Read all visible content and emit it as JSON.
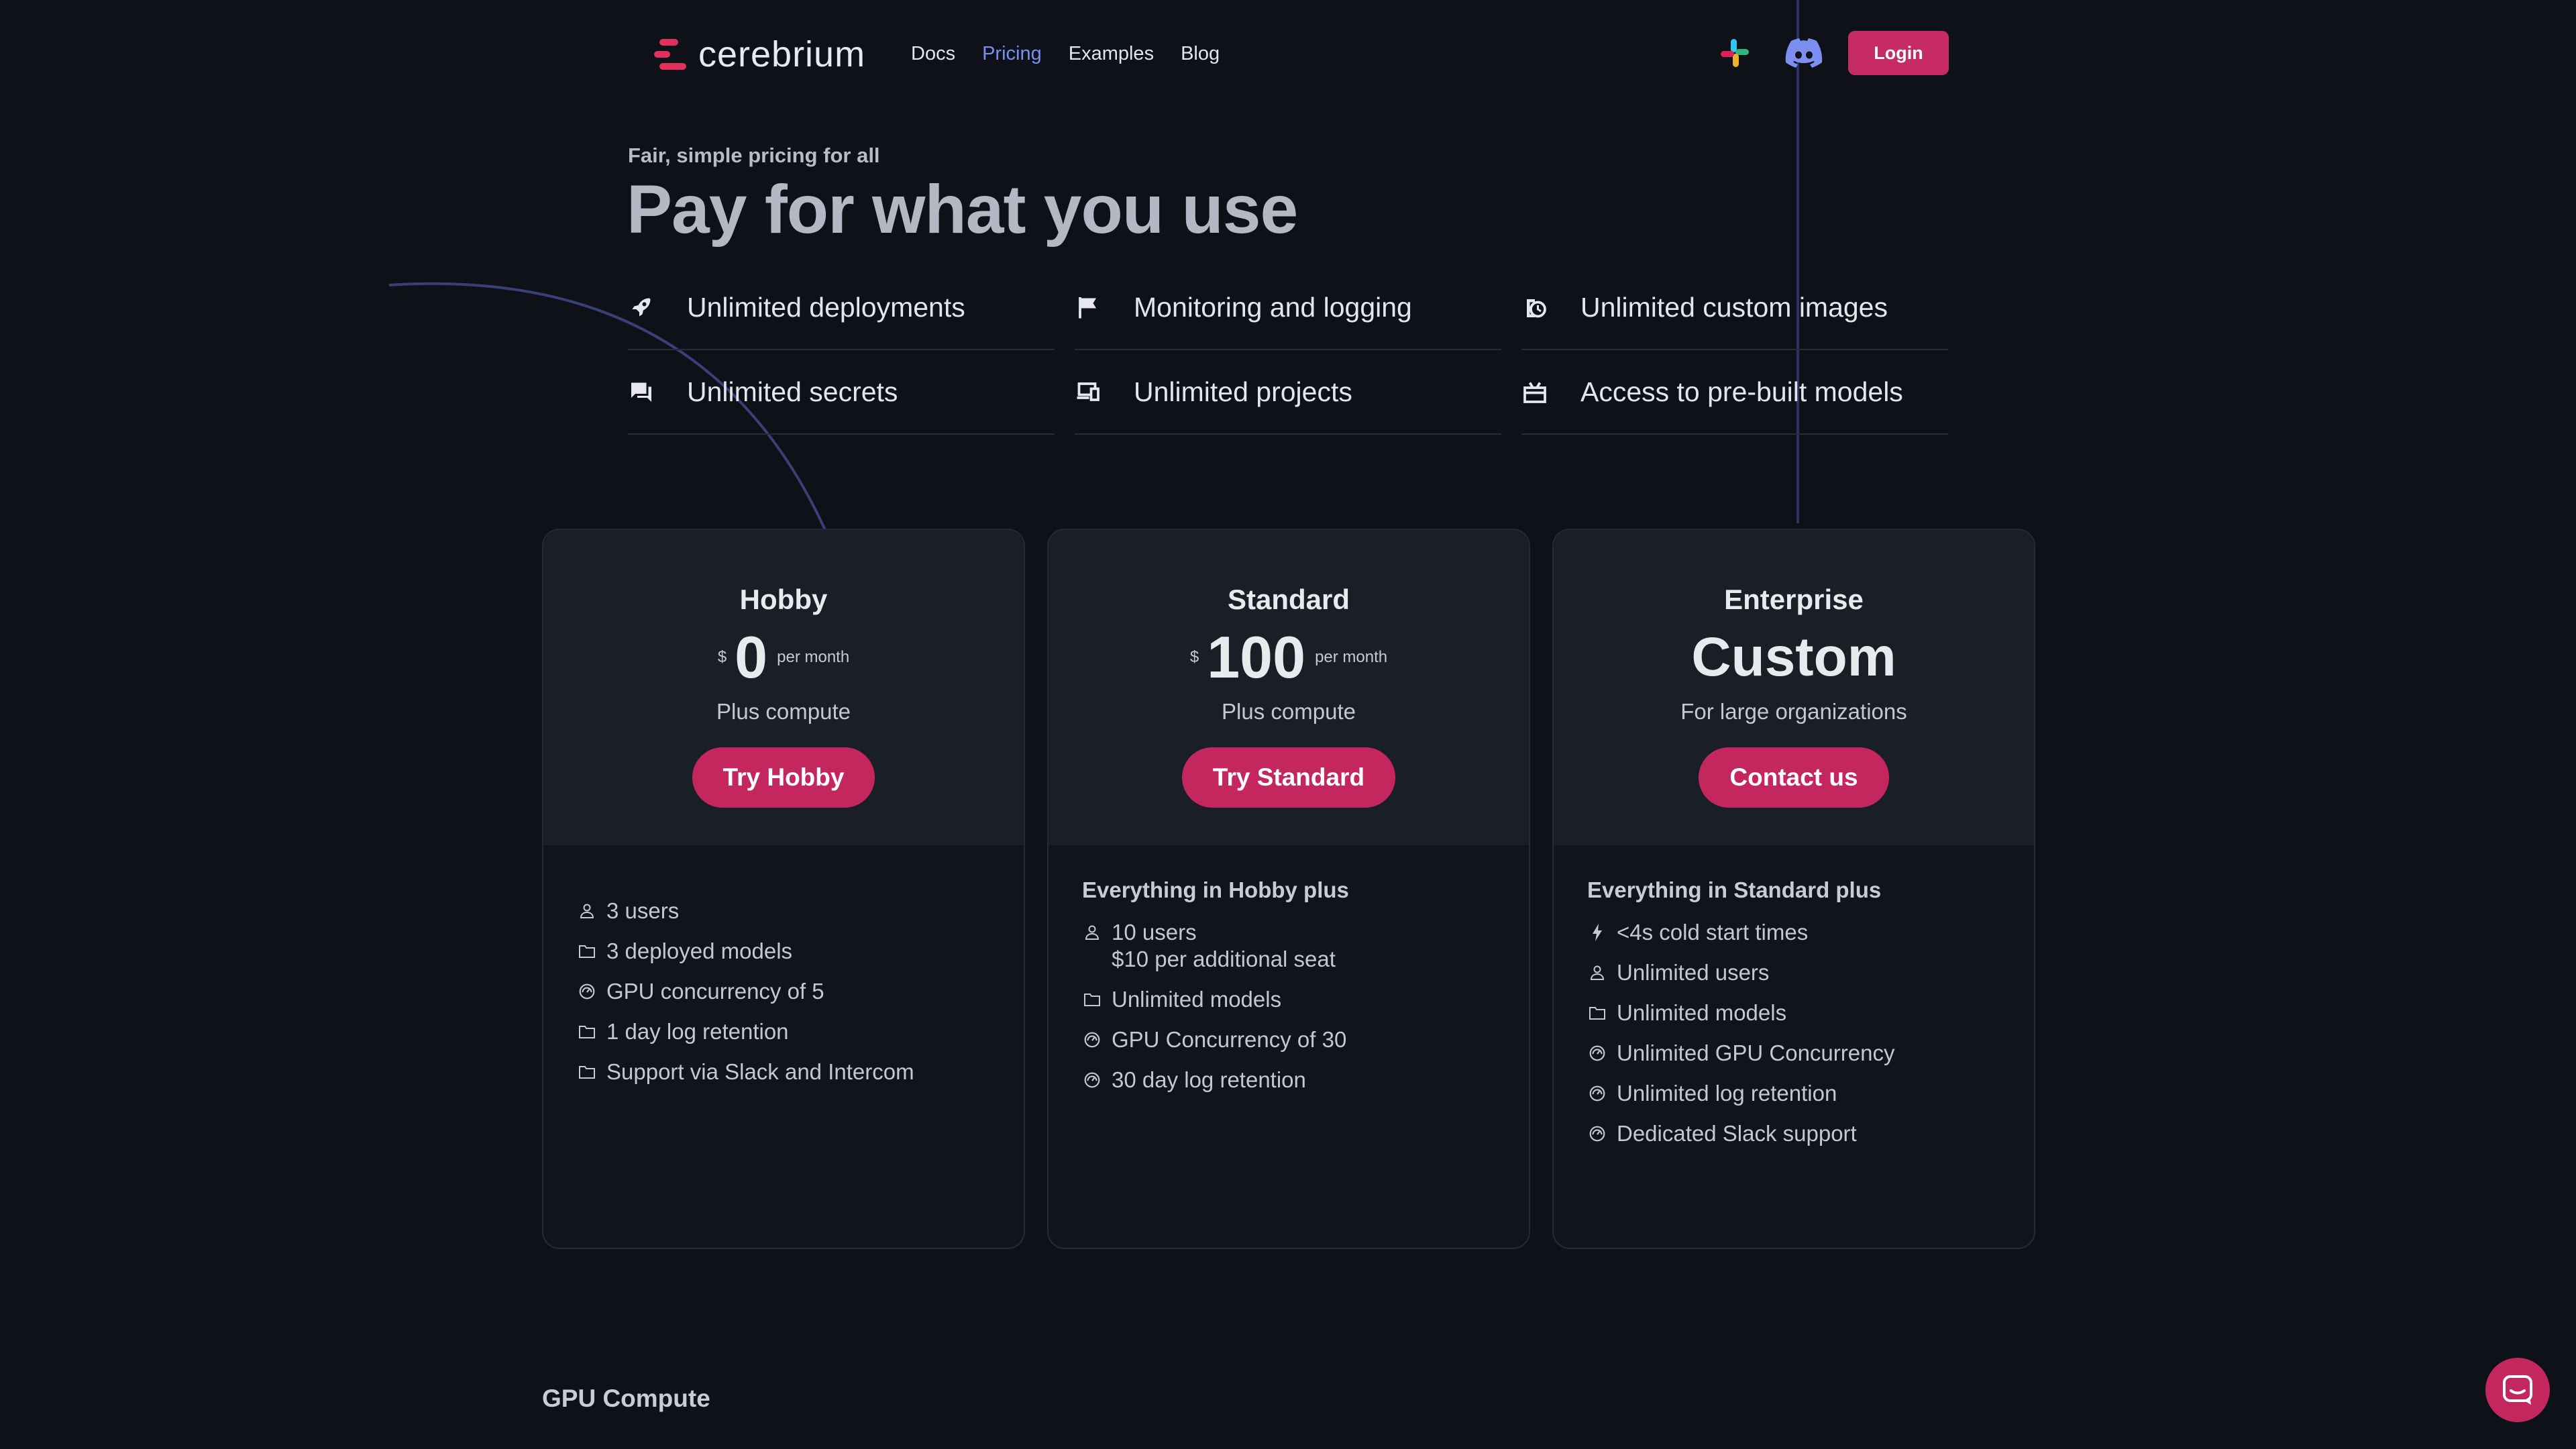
{
  "brand": {
    "name": "cerebrium",
    "accent": "#c4275e"
  },
  "nav": {
    "links": [
      {
        "label": "Docs",
        "active": false
      },
      {
        "label": "Pricing",
        "active": true
      },
      {
        "label": "Examples",
        "active": false
      },
      {
        "label": "Blog",
        "active": false
      }
    ],
    "login_label": "Login"
  },
  "hero": {
    "eyebrow": "Fair, simple pricing for all",
    "title": "Pay for what you use"
  },
  "features": [
    {
      "icon": "rocket-icon",
      "label": "Unlimited deployments"
    },
    {
      "icon": "flag-icon",
      "label": "Monitoring and logging"
    },
    {
      "icon": "clock-icon",
      "label": "Unlimited custom images"
    },
    {
      "icon": "chat-icon",
      "label": "Unlimited secrets"
    },
    {
      "icon": "devices-icon",
      "label": "Unlimited projects"
    },
    {
      "icon": "package-icon",
      "label": "Access to pre-built models"
    }
  ],
  "plans": [
    {
      "name": "Hobby",
      "currency": "$",
      "price": "0",
      "period": "per month",
      "subtitle": "Plus compute",
      "cta": "Try Hobby",
      "includes": "",
      "items": [
        {
          "icon": "user-icon",
          "lines": [
            "3 users"
          ]
        },
        {
          "icon": "folder-icon",
          "lines": [
            "3 deployed models"
          ]
        },
        {
          "icon": "gauge-icon",
          "lines": [
            "GPU concurrency of 5"
          ]
        },
        {
          "icon": "folder-icon",
          "lines": [
            "1 day log retention"
          ]
        },
        {
          "icon": "folder-icon",
          "lines": [
            "Support via Slack and Intercom"
          ]
        }
      ]
    },
    {
      "name": "Standard",
      "currency": "$",
      "price": "100",
      "period": "per month",
      "subtitle": "Plus compute",
      "cta": "Try Standard",
      "includes": "Everything in Hobby plus",
      "items": [
        {
          "icon": "user-icon",
          "lines": [
            "10 users",
            "$10 per additional seat"
          ]
        },
        {
          "icon": "folder-icon",
          "lines": [
            "Unlimited models"
          ]
        },
        {
          "icon": "gauge-icon",
          "lines": [
            "GPU Concurrency of 30"
          ]
        },
        {
          "icon": "gauge-icon",
          "lines": [
            "30 day log retention"
          ]
        }
      ]
    },
    {
      "name": "Enterprise",
      "custom_price": "Custom",
      "subtitle": "For large organizations",
      "cta": "Contact us",
      "includes": "Everything in Standard plus",
      "items": [
        {
          "icon": "bolt-icon",
          "lines": [
            "<4s cold start times"
          ]
        },
        {
          "icon": "user-icon",
          "lines": [
            "Unlimited users"
          ]
        },
        {
          "icon": "folder-icon",
          "lines": [
            "Unlimited models"
          ]
        },
        {
          "icon": "gauge-icon",
          "lines": [
            "Unlimited GPU Concurrency"
          ]
        },
        {
          "icon": "gauge-icon",
          "lines": [
            "Unlimited log retention"
          ]
        },
        {
          "icon": "gauge-icon",
          "lines": [
            "Dedicated Slack support"
          ]
        }
      ]
    }
  ],
  "section": {
    "gpu_title": "GPU Compute"
  }
}
